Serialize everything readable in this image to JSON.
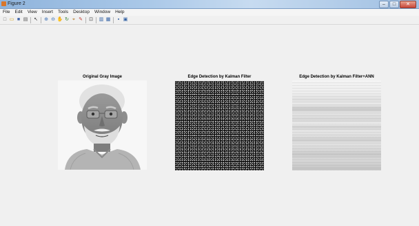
{
  "window": {
    "title": "Figure 2",
    "controls": {
      "minimize": "–",
      "maximize": "□",
      "close": "✕"
    }
  },
  "menubar": {
    "items": [
      "File",
      "Edit",
      "View",
      "Insert",
      "Tools",
      "Desktop",
      "Window",
      "Help"
    ]
  },
  "toolbar": {
    "buttons": [
      {
        "name": "new-figure-icon",
        "glyph": "□"
      },
      {
        "name": "open-file-icon",
        "glyph": "▭"
      },
      {
        "name": "save-icon",
        "glyph": "■"
      },
      {
        "name": "print-icon",
        "glyph": "▤"
      },
      {
        "name": "pointer-icon",
        "glyph": "↖"
      },
      {
        "name": "zoom-in-icon",
        "glyph": "⊕"
      },
      {
        "name": "zoom-out-icon",
        "glyph": "⊖"
      },
      {
        "name": "pan-icon",
        "glyph": "✋"
      },
      {
        "name": "rotate-icon",
        "glyph": "↻"
      },
      {
        "name": "data-cursor-icon",
        "glyph": "⌖"
      },
      {
        "name": "brush-icon",
        "glyph": "✎"
      },
      {
        "name": "link-icon",
        "glyph": "⊡"
      },
      {
        "name": "colorbar-icon",
        "glyph": "▥"
      },
      {
        "name": "legend-icon",
        "glyph": "▦"
      },
      {
        "name": "hide-plot-tools-icon",
        "glyph": "▪"
      },
      {
        "name": "show-plot-tools-icon",
        "glyph": "▣"
      }
    ]
  },
  "figure": {
    "panels": [
      {
        "title": "Original Gray Image"
      },
      {
        "title": "Edge Detection by Kalman Filter"
      },
      {
        "title": "Edge Detection by Kalman Filter+ANN"
      }
    ]
  }
}
